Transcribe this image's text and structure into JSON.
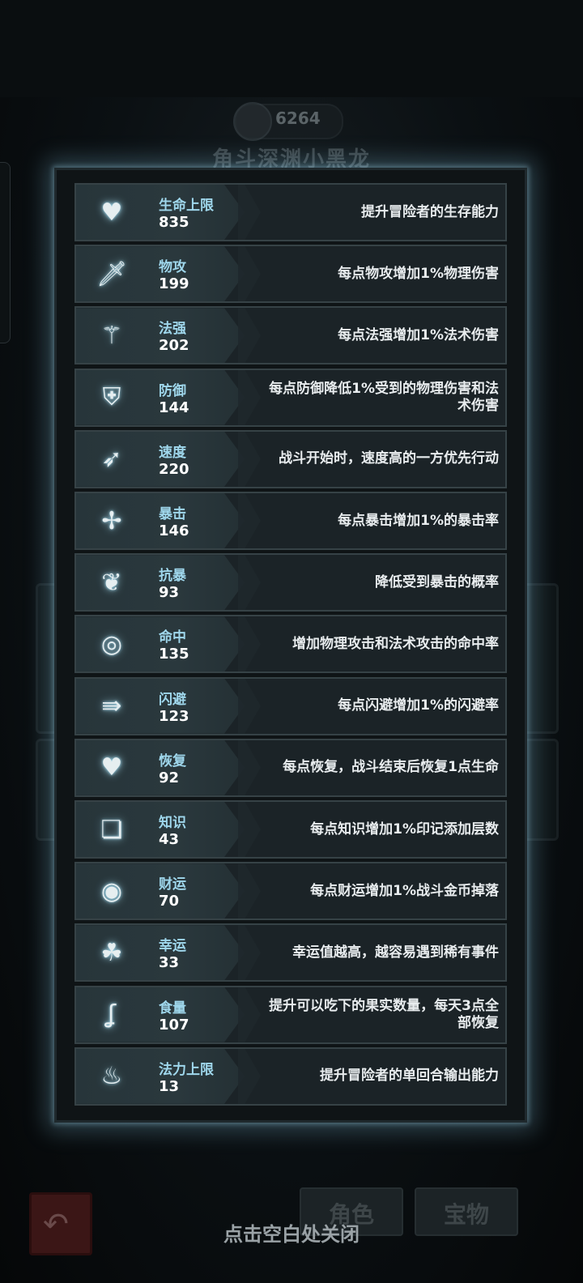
{
  "background": {
    "gold_amount": "6264",
    "character_title": "角斗深渊小黑龙",
    "buttons": [
      "角色",
      "宝物"
    ]
  },
  "stats": [
    {
      "name": "生命上限",
      "value": "835",
      "desc": "提升冒险者的生存能力",
      "icon": "heart-arrow-icon"
    },
    {
      "name": "物攻",
      "value": "199",
      "desc": "每点物攻增加1%物理伤害",
      "icon": "sword-icon"
    },
    {
      "name": "法强",
      "value": "202",
      "desc": "每点法强增加1%法术伤害",
      "icon": "staff-icon"
    },
    {
      "name": "防御",
      "value": "144",
      "desc": "每点防御降低1%受到的物理伤害和法术伤害",
      "icon": "armor-icon"
    },
    {
      "name": "速度",
      "value": "220",
      "desc": "战斗开始时，速度高的一方优先行动",
      "icon": "winged-boot-icon"
    },
    {
      "name": "暴击",
      "value": "146",
      "desc": "每点暴击增加1%的暴击率",
      "icon": "critical-dagger-icon"
    },
    {
      "name": "抗暴",
      "value": "93",
      "desc": "降低受到暴击的概率",
      "icon": "crit-resist-icon"
    },
    {
      "name": "命中",
      "value": "135",
      "desc": "增加物理攻击和法术攻击的命中率",
      "icon": "target-icon"
    },
    {
      "name": "闪避",
      "value": "123",
      "desc": "每点闪避增加1%的闪避率",
      "icon": "dash-arrow-icon"
    },
    {
      "name": "恢复",
      "value": "92",
      "desc": "每点恢复，战斗结束后恢复1点生命",
      "icon": "heart-plus-icon"
    },
    {
      "name": "知识",
      "value": "43",
      "desc": "每点知识增加1%印记添加层数",
      "icon": "book-icon"
    },
    {
      "name": "财运",
      "value": "70",
      "desc": "每点财运增加1%战斗金币掉落",
      "icon": "coin-icon"
    },
    {
      "name": "幸运",
      "value": "33",
      "desc": "幸运值越高，越容易遇到稀有事件",
      "icon": "clover-icon"
    },
    {
      "name": "食量",
      "value": "107",
      "desc": "提升可以吃下的果实数量，每天3点全部恢复",
      "icon": "stomach-icon"
    },
    {
      "name": "法力上限",
      "value": "13",
      "desc": "提升冒险者的单回合输出能力",
      "icon": "mana-drop-icon"
    }
  ],
  "close_hint": "点击空白处关闭",
  "colors": {
    "accent_glow": "#8ccdeb",
    "stat_name": "#9fd7ec"
  }
}
